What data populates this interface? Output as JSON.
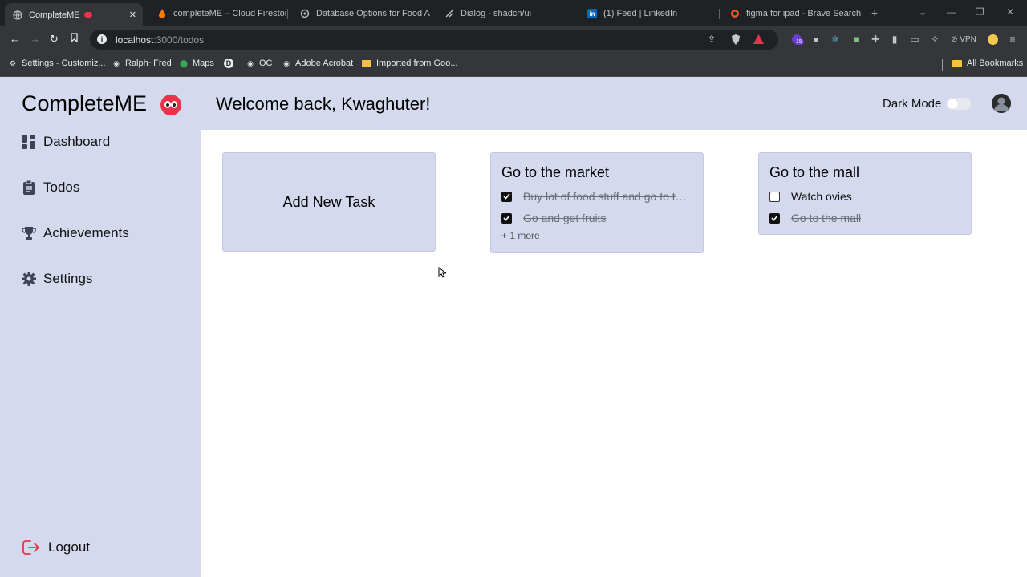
{
  "browser": {
    "tabs": [
      {
        "label": "CompleteME",
        "active": true
      },
      {
        "label": "completeME – Cloud Firestore"
      },
      {
        "label": "Database Options for Food App"
      },
      {
        "label": "Dialog - shadcn/ui"
      },
      {
        "label": "(1) Feed | LinkedIn"
      },
      {
        "label": "figma for ipad - Brave Search"
      }
    ],
    "url_host": "localhost",
    "url_path": ":3000/todos",
    "vpn_label": "VPN",
    "extension_badge": "15",
    "bookmarks": [
      "Settings - Customiz...",
      "Ralph~Fred",
      "Maps",
      "OC",
      "Adobe Acrobat",
      "Imported from Goo..."
    ],
    "all_bookmarks": "All Bookmarks"
  },
  "app": {
    "logo": "CompleteME",
    "welcome": "Welcome back, Kwaghuter!",
    "dark_mode_label": "Dark Mode",
    "dark_mode_on": false,
    "nav": [
      {
        "label": "Dashboard",
        "icon": "dashboard-icon"
      },
      {
        "label": "Todos",
        "icon": "clipboard-icon"
      },
      {
        "label": "Achievements",
        "icon": "trophy-icon"
      },
      {
        "label": "Settings",
        "icon": "gear-icon"
      }
    ],
    "logout": "Logout",
    "add_task_label": "Add New Task",
    "cards": [
      {
        "title": "Go to the market",
        "items": [
          {
            "text": "Buy lot of food stuff and go to the market",
            "done": true
          },
          {
            "text": "Go and get fruits",
            "done": true
          }
        ],
        "more": "+ 1 more"
      },
      {
        "title": "Go to the mall",
        "items": [
          {
            "text": "Watch ovies",
            "done": false
          },
          {
            "text": "Go to the mall",
            "done": true
          }
        ]
      }
    ]
  },
  "colors": {
    "panel": "#d4d9ee",
    "logo_badge": "#e8334a",
    "logout_icon": "#e8334a"
  }
}
